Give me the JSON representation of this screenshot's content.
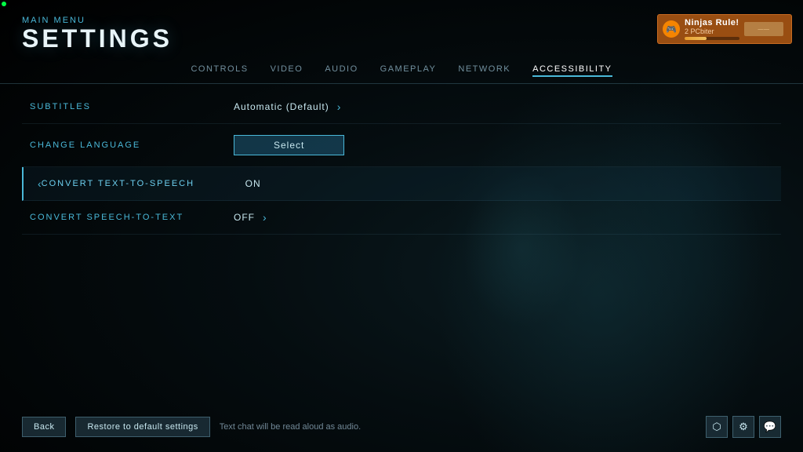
{
  "corner": {
    "indicator": "online"
  },
  "header": {
    "breadcrumb": "MAIN MENU",
    "title": "SETTINGS"
  },
  "user": {
    "name": "Ninjas Rule!",
    "subtitle": "2 PCbiter",
    "progress": 40
  },
  "tabs": [
    {
      "id": "controls",
      "label": "CONTROLS",
      "active": false
    },
    {
      "id": "video",
      "label": "VIDEO",
      "active": false
    },
    {
      "id": "audio",
      "label": "AUDIO",
      "active": false
    },
    {
      "id": "gameplay",
      "label": "GAMEPLAY",
      "active": false
    },
    {
      "id": "network",
      "label": "NETWORK",
      "active": false
    },
    {
      "id": "accessibility",
      "label": "ACCESSIBILITY",
      "active": true
    }
  ],
  "settings": [
    {
      "id": "subtitles",
      "label": "SUBTITLES",
      "value": "Automatic (Default)",
      "has_right_arrow": true,
      "has_left_arrow": false,
      "active": false,
      "type": "value"
    },
    {
      "id": "change-language",
      "label": "CHANGE LANGUAGE",
      "value": "Select",
      "has_right_arrow": false,
      "has_left_arrow": false,
      "active": false,
      "type": "button"
    },
    {
      "id": "convert-text-to-speech",
      "label": "CONVERT TEXT-TO-SPEECH",
      "value": "ON",
      "has_right_arrow": false,
      "has_left_arrow": true,
      "active": true,
      "type": "value"
    },
    {
      "id": "convert-speech-to-text",
      "label": "CONVERT SPEECH-TO-TEXT",
      "value": "OFF",
      "has_right_arrow": true,
      "has_left_arrow": false,
      "active": false,
      "type": "value"
    }
  ],
  "footer": {
    "hint": "Text chat will be read aloud as audio.",
    "back_label": "Back",
    "restore_label": "Restore to default settings"
  },
  "icons": {
    "steam": "⬡",
    "gear": "⚙",
    "chat": "💬"
  }
}
